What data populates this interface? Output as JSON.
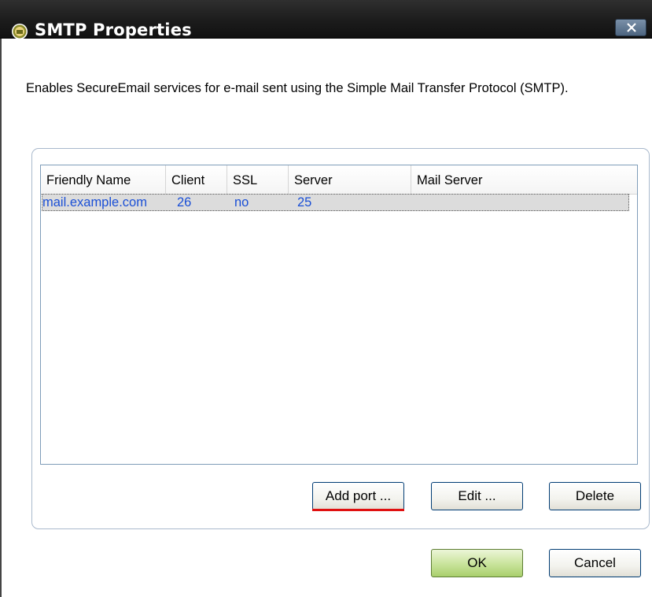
{
  "window": {
    "title": "SMTP Properties",
    "description": "Enables SecureEmail services for e-mail sent using the Simple Mail Transfer Protocol (SMTP)."
  },
  "listview": {
    "columns": [
      "Friendly Name",
      "Client",
      "SSL",
      "Server",
      "Mail Server"
    ],
    "rows": [
      {
        "friendly_name": "mail.example.com",
        "client": "26",
        "ssl": "no",
        "server": "25",
        "mail_server": ""
      }
    ]
  },
  "buttons": {
    "add_port": "Add port ...",
    "edit": "Edit ...",
    "delete": "Delete",
    "ok": "OK",
    "cancel": "Cancel"
  },
  "icons": {
    "app": "app-icon",
    "close": "close-icon"
  },
  "colors": {
    "link_text": "#1a4fd6",
    "highlight_underline": "#e01010",
    "ok_button": "#a9cf6c"
  }
}
